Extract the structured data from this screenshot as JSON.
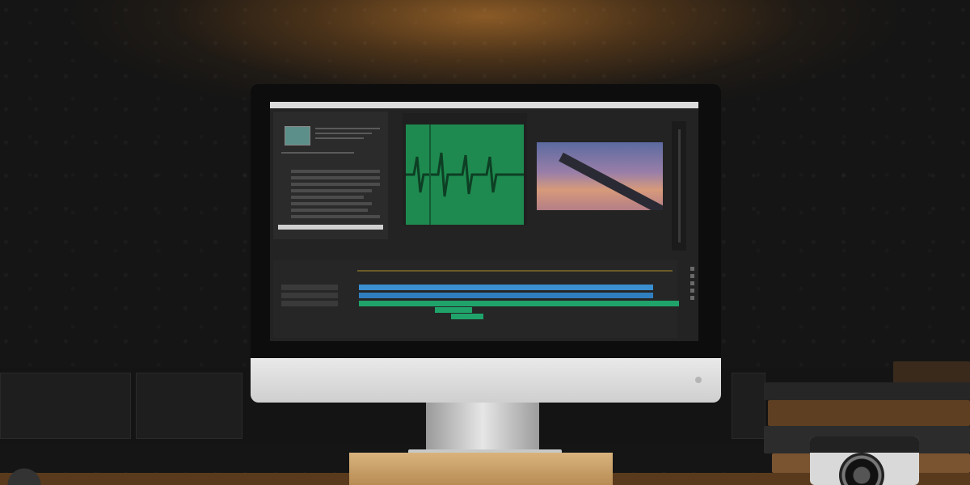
{
  "scene": {
    "subject": "imac-video-editing",
    "colors": {
      "wall_glow": "#8a5a26",
      "wall_dark": "#151515",
      "waveform_green": "#1e8a4f",
      "track_blue": "#3a8fd1",
      "track_green": "#1fa36a",
      "desk_wood": "#d9b37c"
    },
    "icons": [
      "power-icon",
      "camera-icon",
      "books-icon"
    ]
  }
}
